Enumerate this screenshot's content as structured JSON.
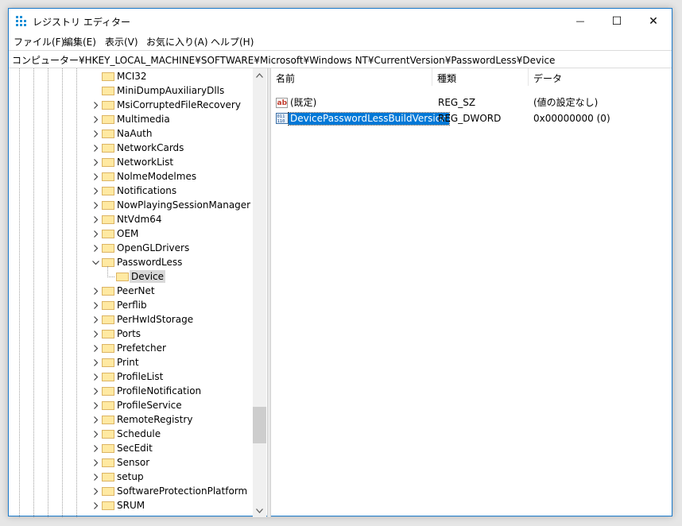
{
  "window": {
    "title": "レジストリ エディター",
    "controls": {
      "minimize": "—",
      "maximize": "☐",
      "close": "✕"
    }
  },
  "menu": [
    "ファイル(F)",
    "編集(E)",
    "表示(V)",
    "お気に入り(A)",
    "ヘルプ(H)"
  ],
  "address": "コンピューター¥HKEY_LOCAL_MACHINE¥SOFTWARE¥Microsoft¥Windows NT¥CurrentVersion¥PasswordLess¥Device",
  "tree": {
    "items": [
      {
        "label": "MCI32",
        "expander": "none"
      },
      {
        "label": "MiniDumpAuxiliaryDlls",
        "expander": "none"
      },
      {
        "label": "MsiCorruptedFileRecovery",
        "expander": "collapsed"
      },
      {
        "label": "Multimedia",
        "expander": "collapsed"
      },
      {
        "label": "NaAuth",
        "expander": "collapsed"
      },
      {
        "label": "NetworkCards",
        "expander": "collapsed"
      },
      {
        "label": "NetworkList",
        "expander": "collapsed"
      },
      {
        "label": "NolmeModelmes",
        "expander": "collapsed"
      },
      {
        "label": "Notifications",
        "expander": "collapsed"
      },
      {
        "label": "NowPlayingSessionManager",
        "expander": "collapsed"
      },
      {
        "label": "NtVdm64",
        "expander": "collapsed"
      },
      {
        "label": "OEM",
        "expander": "collapsed"
      },
      {
        "label": "OpenGLDrivers",
        "expander": "collapsed"
      },
      {
        "label": "PasswordLess",
        "expander": "expanded"
      },
      {
        "label": "Device",
        "expander": "child",
        "selected": true
      },
      {
        "label": "PeerNet",
        "expander": "collapsed"
      },
      {
        "label": "Perflib",
        "expander": "collapsed"
      },
      {
        "label": "PerHwIdStorage",
        "expander": "collapsed"
      },
      {
        "label": "Ports",
        "expander": "collapsed"
      },
      {
        "label": "Prefetcher",
        "expander": "collapsed"
      },
      {
        "label": "Print",
        "expander": "collapsed"
      },
      {
        "label": "ProfileList",
        "expander": "collapsed"
      },
      {
        "label": "ProfileNotification",
        "expander": "collapsed"
      },
      {
        "label": "ProfileService",
        "expander": "collapsed"
      },
      {
        "label": "RemoteRegistry",
        "expander": "collapsed"
      },
      {
        "label": "Schedule",
        "expander": "collapsed"
      },
      {
        "label": "SecEdit",
        "expander": "collapsed"
      },
      {
        "label": "Sensor",
        "expander": "collapsed"
      },
      {
        "label": "setup",
        "expander": "collapsed"
      },
      {
        "label": "SoftwareProtectionPlatform",
        "expander": "collapsed"
      },
      {
        "label": "SRUM",
        "expander": "collapsed"
      }
    ]
  },
  "list": {
    "columns": [
      "名前",
      "種類",
      "データ"
    ],
    "rows": [
      {
        "icon": "string-value-icon",
        "name": "(既定)",
        "type": "REG_SZ",
        "data": "(値の設定なし)",
        "selected": false
      },
      {
        "icon": "binary-value-icon",
        "name": "DevicePasswordLessBuildVersion",
        "type": "REG_DWORD",
        "data": "0x00000000 (0)",
        "selected": true
      }
    ]
  },
  "colors": {
    "selection": "#0078d7",
    "folder": "#ffe9a2",
    "tree_selection": "#d9d9d9"
  }
}
